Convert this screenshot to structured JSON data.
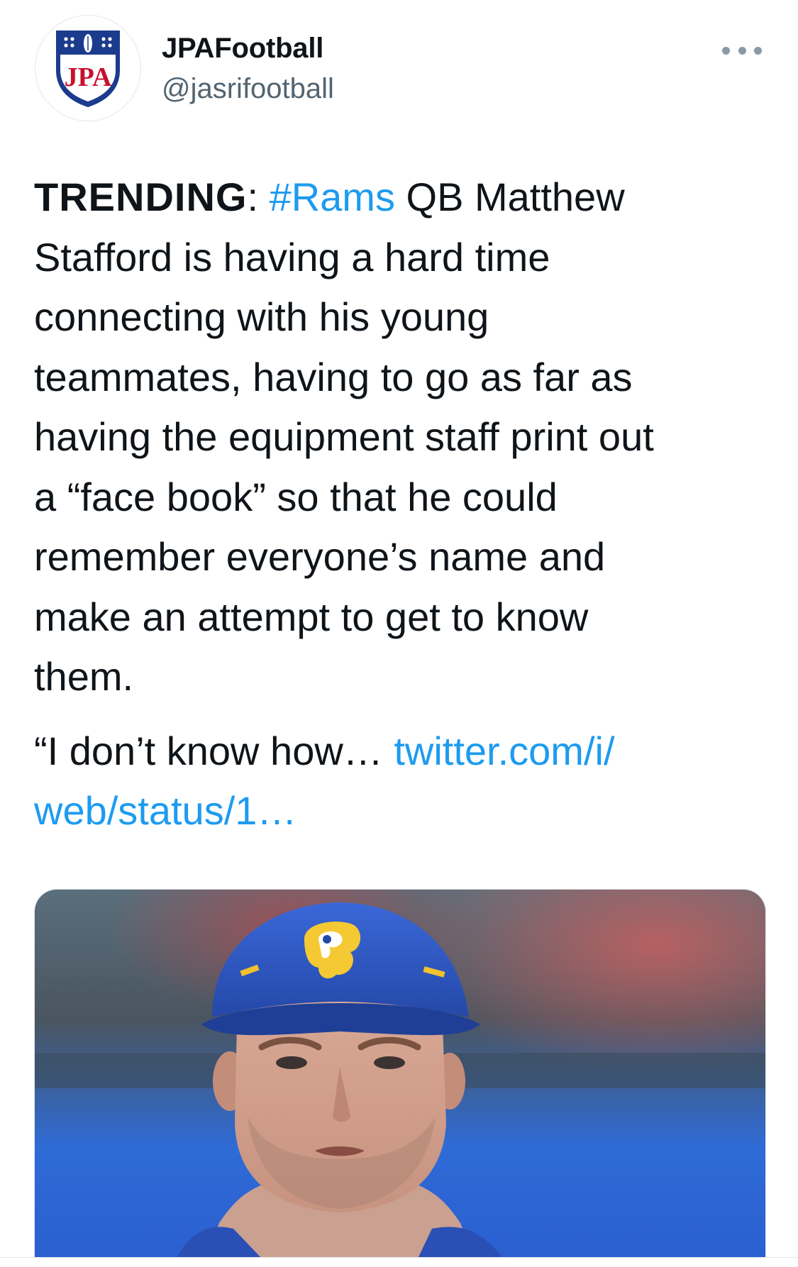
{
  "account": {
    "display_name": "JPAFootball",
    "handle": "@jasrifootball",
    "avatar_text": "JPA",
    "avatar_icon": "jpa-shield-logo-icon",
    "avatar_colors": {
      "shield_blue": "#1b3b8c",
      "shield_red": "#c8102e"
    }
  },
  "menu": {
    "icon": "more-options-icon"
  },
  "tweet": {
    "label": "TRENDING",
    "colon": ": ",
    "hashtag": "#Rams",
    "line1_rest": " QB Matthew",
    "line2": "Stafford is having a hard time",
    "line3": "connecting with his young",
    "line4": "teammates, having to go as far as",
    "line5": "having the equipment staff print out",
    "line6": "a “face book” so that he could",
    "line7": "remember everyone’s name and",
    "line8": "make an attempt to get to know",
    "line9": "them.",
    "quote_start": "“I don’t know how… ",
    "link_part1": "twitter.com/i/",
    "link_part2": "web/status/1…"
  },
  "media": {
    "description_icon": "player-photo-image"
  },
  "colors": {
    "link": "#1d9bf0",
    "text": "#0f1419",
    "secondary": "#536471"
  }
}
